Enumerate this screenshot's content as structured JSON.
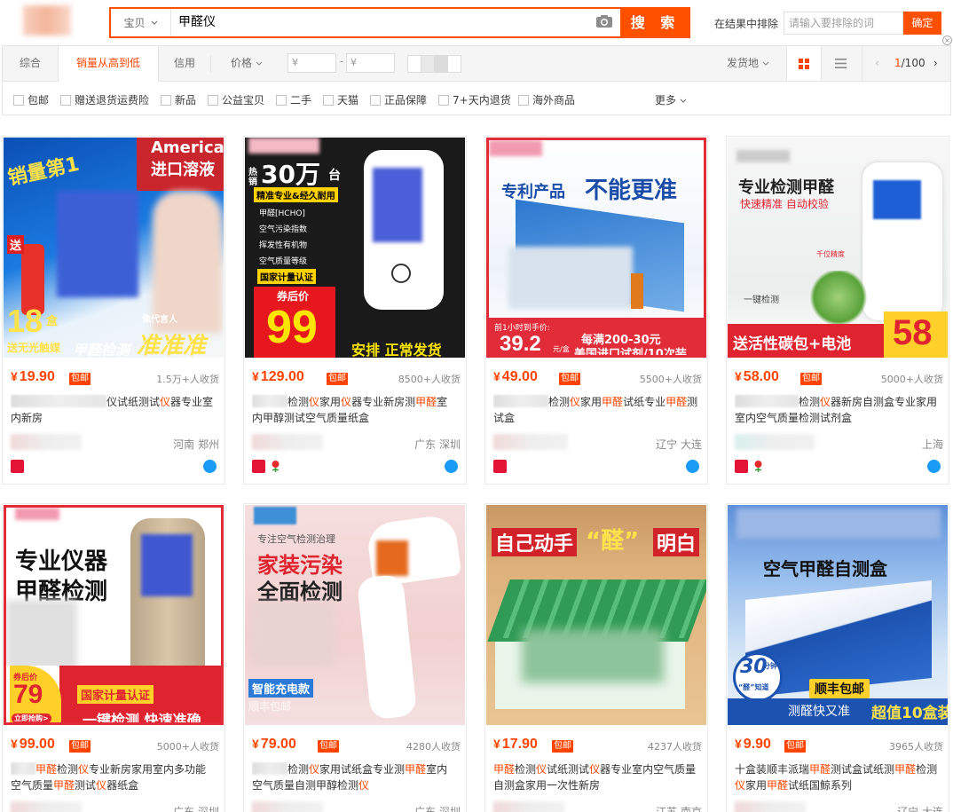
{
  "search": {
    "type_label": "宝贝",
    "query": "甲醛仪",
    "button": "搜 索",
    "exclude_label": "在结果中排除",
    "exclude_placeholder": "请输入要排除的词",
    "confirm": "确定"
  },
  "sortbar": {
    "tabs": [
      "综合",
      "销量从高到低",
      "信用"
    ],
    "price_label": "价格",
    "price_min_placeholder": "¥",
    "price_max_placeholder": "¥",
    "price_dash": "-",
    "ship_from": "发货地",
    "page_current": "1",
    "page_total": "/100"
  },
  "checks": [
    "包邮",
    "赠送退货运费险",
    "新品",
    "公益宝贝",
    "二手",
    "天猫",
    "正品保障",
    "7+天内退货",
    "海外商品"
  ],
  "more": "更多",
  "badge": "包邮",
  "products": [
    {
      "price": "19.90",
      "sales": "1.5万+人收货",
      "title_parts": [
        [
          "",
          "#blur100"
        ],
        [
          "",
          "仪试纸测试"
        ],
        [
          "hl",
          "仪"
        ],
        [
          "",
          "器专业室内新房"
        ]
      ],
      "loc": "河南 郑州",
      "tmall": true,
      "flower": false,
      "art": {
        "a1": "America",
        "a2": "进口溶液",
        "a3": "销量第1",
        "a4": "送",
        "a5": "18",
        "a6": "盒",
        "a7": "送无光触媒",
        "a8": "甲醛检测",
        "a9": "准准准",
        "a10": "像代言人"
      }
    },
    {
      "price": "129.00",
      "sales": "8500+人收货",
      "title_parts": [
        [
          "",
          "#blur40"
        ],
        [
          "",
          "检测"
        ],
        [
          "hl",
          "仪"
        ],
        [
          "",
          "家用"
        ],
        [
          "hl",
          "仪"
        ],
        [
          "",
          "器专业新房测"
        ],
        [
          "hl",
          "甲醛"
        ],
        [
          "",
          "室内甲醇测试空气质量纸盒"
        ]
      ],
      "loc": "广东 深圳",
      "tmall": true,
      "flower": true,
      "art": {
        "a1": "热销",
        "a2": "30万",
        "a3": "台",
        "a4": "精准专业&经久耐用",
        "a5": "甲醛[HCHO]",
        "a6": "空气污染指数",
        "a7": "挥发性有机物",
        "a8": "空气质量等级",
        "a9": "国家计量认证",
        "a10": "券后价",
        "a11": "99",
        "a12": "安排 正常发货"
      }
    },
    {
      "price": "49.00",
      "sales": "5500+人收货",
      "title_parts": [
        [
          "",
          "#blur60"
        ],
        [
          "",
          "检测"
        ],
        [
          "hl",
          "仪"
        ],
        [
          "",
          "家用"
        ],
        [
          "hl",
          "甲醛"
        ],
        [
          "",
          "试纸专业"
        ],
        [
          "hl",
          "甲醛"
        ],
        [
          "",
          "测试盒"
        ]
      ],
      "loc": "辽宁 大连",
      "tmall": true,
      "flower": false,
      "art": {
        "a1": "专利产品",
        "a2": "不能更准",
        "a3": "前1小时到手价:",
        "a4": "39.2",
        "a5": "元/盒",
        "a6": "每满200-30元",
        "a7": "美国进口试剂/10次装"
      }
    },
    {
      "price": "58.00",
      "sales": "5000+人收货",
      "title_parts": [
        [
          "",
          "#blur70"
        ],
        [
          "",
          "检测"
        ],
        [
          "hl",
          "仪"
        ],
        [
          "",
          "器新房自测盒专业家用室内空气质量检测试剂盒"
        ]
      ],
      "loc": "上海",
      "tmall": true,
      "flower": true,
      "art": {
        "a1": "专业检测甲醛",
        "a2": "快速精准 自动校验",
        "a3": "千位精度",
        "a4": "一键检测",
        "a5": "送活性碳包+电池",
        "a6": "58"
      }
    },
    {
      "price": "99.00",
      "sales": "5000+人收货",
      "title_parts": [
        [
          "",
          "#blur28"
        ],
        [
          "hl",
          "甲醛"
        ],
        [
          "",
          "检测"
        ],
        [
          "hl",
          "仪"
        ],
        [
          "",
          "专业新房家用室内多功能空气质量"
        ],
        [
          "hl",
          "甲醛"
        ],
        [
          "",
          "测试"
        ],
        [
          "hl",
          "仪"
        ],
        [
          "",
          "器纸盒"
        ]
      ],
      "loc": "广东 深圳",
      "tmall": false,
      "flower": false,
      "art": {
        "a1": "专业仪器",
        "a2": "甲醛检测",
        "a3": "券后价",
        "a4": "79",
        "a5": "立即抢购>",
        "a6": "国家计量认证",
        "a7": "一键检测 快速准确"
      }
    },
    {
      "price": "79.00",
      "sales": "4280人收货",
      "title_parts": [
        [
          "",
          "#blur40"
        ],
        [
          "",
          "检测"
        ],
        [
          "hl",
          "仪"
        ],
        [
          "",
          "家用试纸盒专业测"
        ],
        [
          "hl",
          "甲醛"
        ],
        [
          "",
          "室内空气质量自测甲醇检测"
        ],
        [
          "hl",
          "仪"
        ]
      ],
      "loc": "广东 深圳",
      "tmall": false,
      "flower": false,
      "art": {
        "a1": "专注空气检测治理",
        "a2": "家装污染",
        "a3": "全面检测",
        "a4": "智能充电款",
        "a5": "顺丰包邮"
      }
    },
    {
      "price": "17.90",
      "sales": "4237人收货",
      "title_parts": [
        [
          "hl",
          "甲醛"
        ],
        [
          "",
          "检测"
        ],
        [
          "hl",
          "仪"
        ],
        [
          "",
          "试纸测试"
        ],
        [
          "hl",
          "仪"
        ],
        [
          "",
          "器专业室内空气质量自测盒家用一次性新房"
        ]
      ],
      "loc": "江苏 南京",
      "tmall": false,
      "flower": false,
      "art": {
        "a1": "自己动手",
        "a2": "“醛”",
        "a3": "明白"
      }
    },
    {
      "price": "9.90",
      "sales": "3965人收货",
      "title_parts": [
        [
          "",
          "十盒装顺丰派瑞"
        ],
        [
          "hl",
          "甲醛"
        ],
        [
          "",
          "测试盒试纸测"
        ],
        [
          "hl",
          "甲醛"
        ],
        [
          "",
          "检测"
        ],
        [
          "hl",
          "仪"
        ],
        [
          "",
          "家用"
        ],
        [
          "hl",
          "甲醛"
        ],
        [
          "",
          "试纸国鲸系列"
        ]
      ],
      "loc": "辽宁 大连",
      "tmall": false,
      "flower": false,
      "art": {
        "a1": "空气甲醛自测盒",
        "a2": "30",
        "a3": "分钟",
        "a4": "“醛”知道",
        "a5": "顺丰包邮",
        "a6": "测醛快又准",
        "a7": "超值10盒装"
      }
    }
  ]
}
